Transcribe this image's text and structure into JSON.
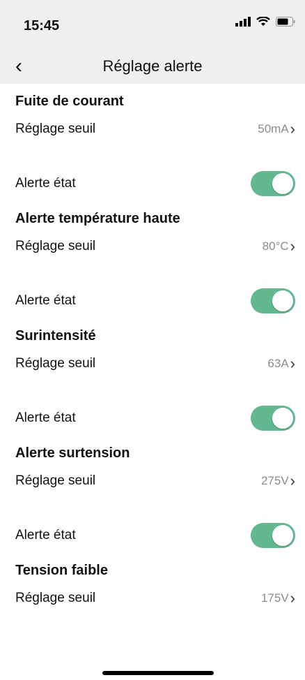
{
  "status_bar": {
    "time": "15:45"
  },
  "nav": {
    "title": "Réglage alerte",
    "back_icon": "‹"
  },
  "sections": [
    {
      "title": "Fuite de courant",
      "threshold_label": "Réglage seuil",
      "threshold_value": "50mA",
      "state_label": "Alerte état",
      "toggle_on": true
    },
    {
      "title": "Alerte température haute",
      "threshold_label": "Réglage seuil",
      "threshold_value": "80°C",
      "state_label": "Alerte état",
      "toggle_on": true
    },
    {
      "title": "Surintensité",
      "threshold_label": "Réglage seuil",
      "threshold_value": "63A",
      "state_label": "Alerte état",
      "toggle_on": true
    },
    {
      "title": "Alerte surtension",
      "threshold_label": "Réglage seuil",
      "threshold_value": "275V",
      "state_label": "Alerte état",
      "toggle_on": true
    },
    {
      "title": "Tension faible",
      "threshold_label": "Réglage seuil",
      "threshold_value": "175V"
    }
  ],
  "colors": {
    "toggle_on": "#63b98f",
    "header_bg": "#efefef",
    "value_text": "#8c8c8c"
  }
}
